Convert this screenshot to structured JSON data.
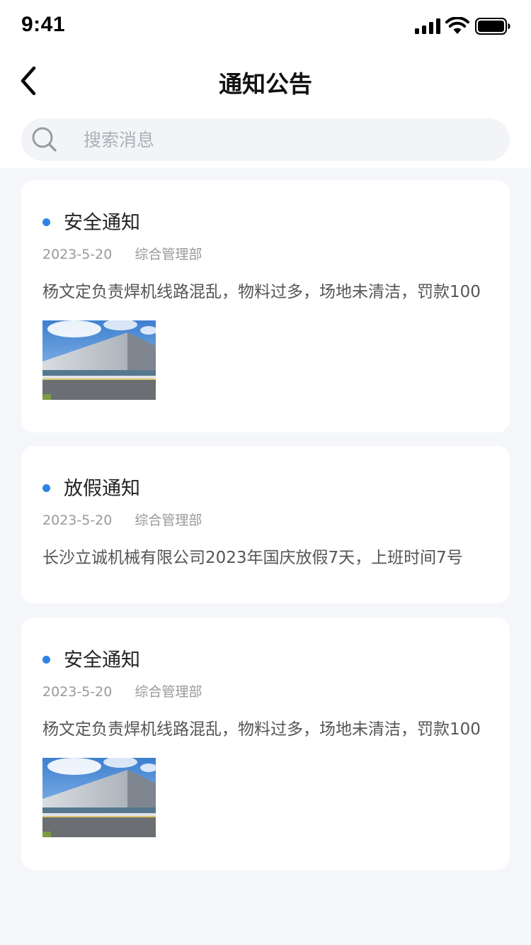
{
  "status_bar": {
    "time": "9:41",
    "icons": [
      "signal-icon",
      "wifi-icon",
      "battery-icon"
    ]
  },
  "nav": {
    "title": "通知公告",
    "back_icon": "chevron-left-icon"
  },
  "search": {
    "placeholder": "搜索消息",
    "value": "",
    "icon": "search-icon"
  },
  "colors": {
    "accent_dot": "#2c84e6",
    "background": "#f5f6fa",
    "card": "#ffffff"
  },
  "notices": [
    {
      "title": "安全通知",
      "date": "2023-5-20",
      "department": "综合管理部",
      "content": "杨文定负责焊机线路混乱，物料过多，场地未清洁，罚款100",
      "has_image": true
    },
    {
      "title": "放假通知",
      "date": "2023-5-20",
      "department": "综合管理部",
      "content": "长沙立诚机械有限公司2023年国庆放假7天，上班时间7号",
      "has_image": false
    },
    {
      "title": "安全通知",
      "date": "2023-5-20",
      "department": "综合管理部",
      "content": "杨文定负责焊机线路混乱，物料过多，场地未清洁，罚款100",
      "has_image": true
    }
  ]
}
